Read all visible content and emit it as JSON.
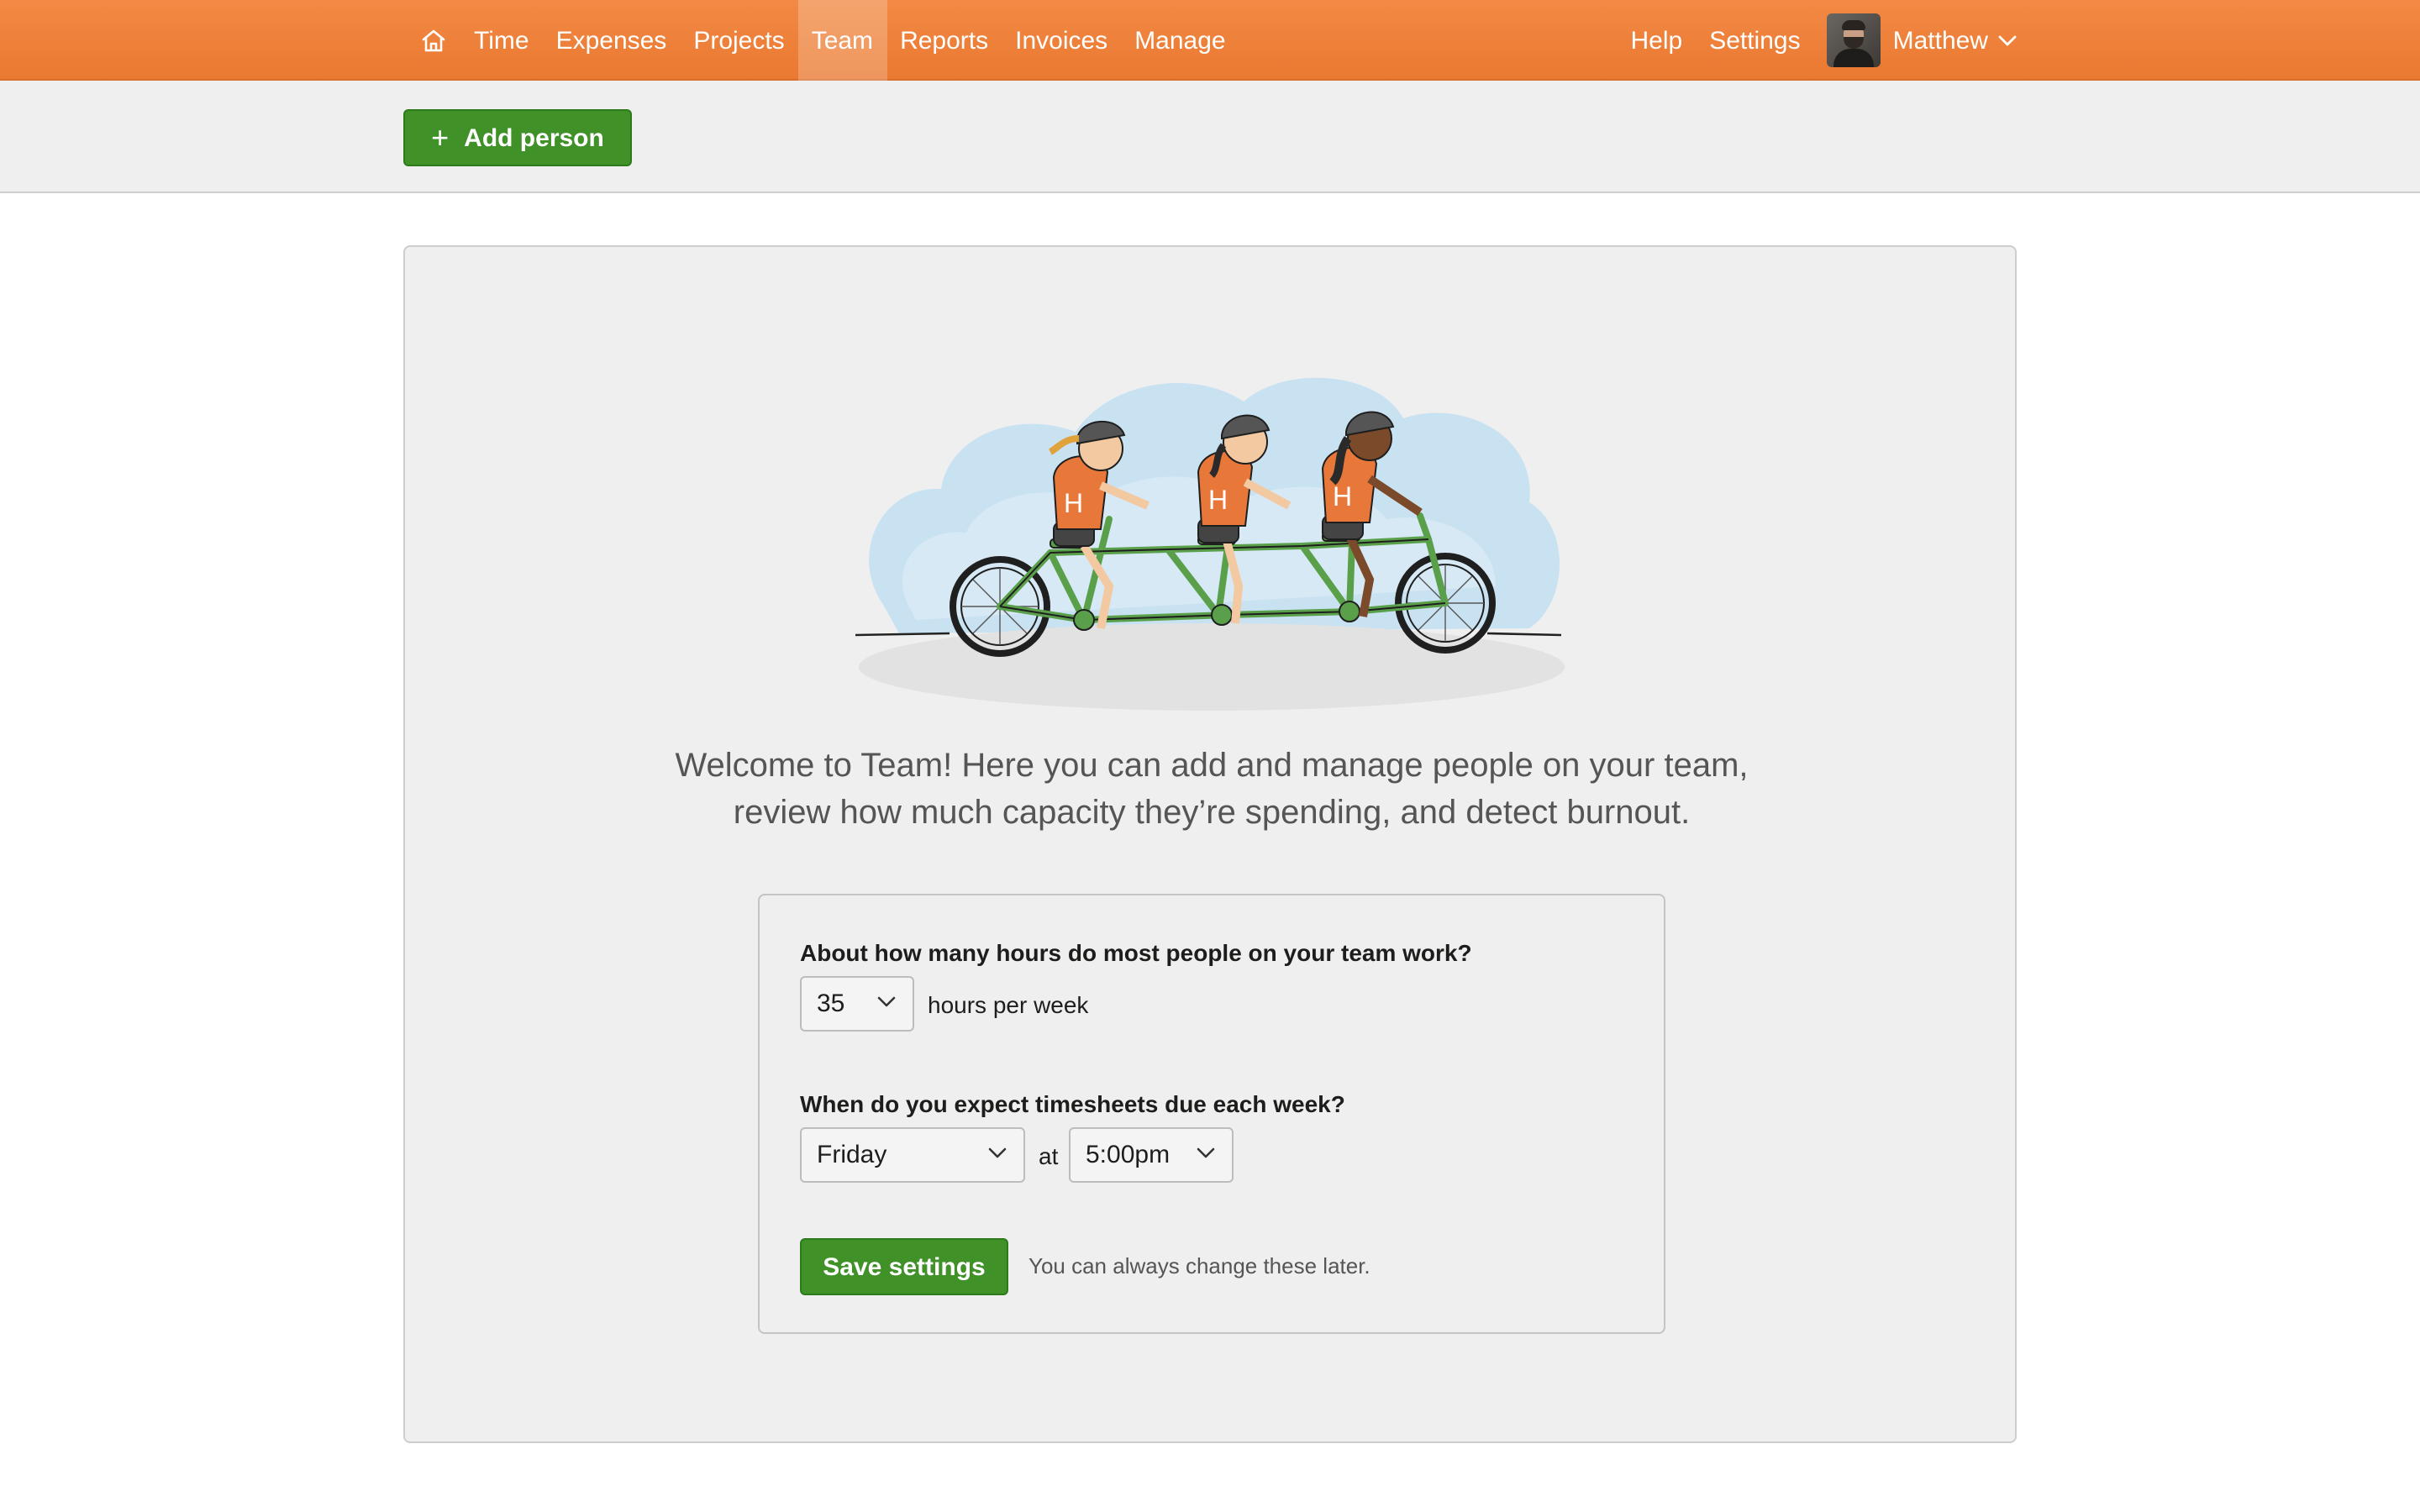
{
  "nav": {
    "home_icon": "home-icon",
    "items": [
      {
        "label": "Time",
        "active": false
      },
      {
        "label": "Expenses",
        "active": false
      },
      {
        "label": "Projects",
        "active": false
      },
      {
        "label": "Team",
        "active": true
      },
      {
        "label": "Reports",
        "active": false
      },
      {
        "label": "Invoices",
        "active": false
      },
      {
        "label": "Manage",
        "active": false
      }
    ],
    "help_label": "Help",
    "settings_label": "Settings",
    "user_name": "Matthew",
    "user_menu_icon": "chevron-down-icon",
    "accent_color": "#ef7f3a"
  },
  "toolbar": {
    "add_person_label": "Add person",
    "add_icon": "plus-icon",
    "button_color": "#3f9128"
  },
  "welcome": {
    "illustration": "three-riders-on-tandem-bicycle",
    "line1": "Welcome to Team! Here you can add and manage people on your team,",
    "line2": "review how much capacity they’re spending, and detect burnout."
  },
  "settings": {
    "hours_question": "About how many hours do most people on your team work?",
    "hours_value": "35",
    "hours_suffix": "hours per week",
    "due_question": "When do you expect timesheets due each week?",
    "due_day": "Friday",
    "due_at": "at",
    "due_time": "5:00pm",
    "save_label": "Save settings",
    "hint": "You can always change these later."
  }
}
